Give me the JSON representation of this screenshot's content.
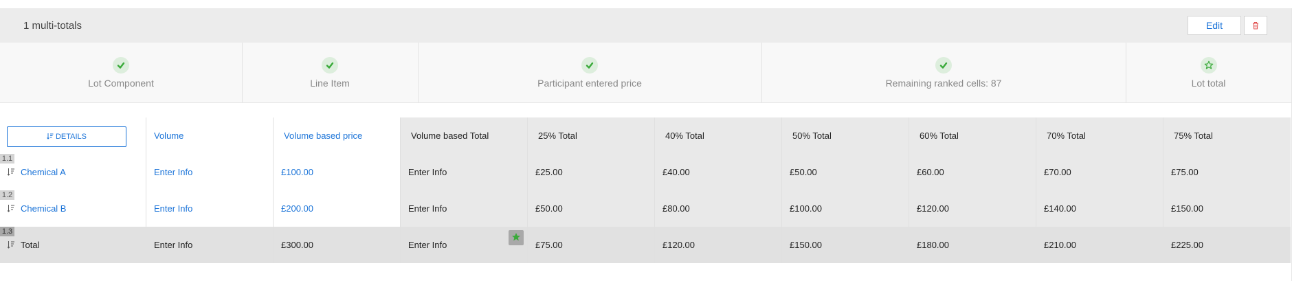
{
  "header": {
    "title": "1 multi-totals",
    "edit_label": "Edit"
  },
  "steps": [
    {
      "label": "Lot Component",
      "icon": "check-icon",
      "status": "complete"
    },
    {
      "label": "Line Item",
      "icon": "check-icon",
      "status": "complete"
    },
    {
      "label": "Participant entered price",
      "icon": "check-icon",
      "status": "complete"
    },
    {
      "label": "Remaining ranked cells: 87",
      "icon": "check-icon",
      "status": "complete"
    },
    {
      "label": "Lot total",
      "icon": "star-outline-icon",
      "status": "pending"
    }
  ],
  "table": {
    "details_label": "DETAILS",
    "columns": [
      "Volume",
      "Volume based price",
      "Volume based Total",
      "25% Total",
      "40% Total",
      "50% Total",
      "60% Total",
      "70% Total",
      "75% Total"
    ],
    "rows": [
      {
        "num": "1.1",
        "name": "Chemical A",
        "cells": [
          "Enter Info",
          "£100.00",
          "Enter Info",
          "£25.00",
          "£40.00",
          "£50.00",
          "£60.00",
          "£70.00",
          "£75.00"
        ]
      },
      {
        "num": "1.2",
        "name": "Chemical B",
        "cells": [
          "Enter Info",
          "£200.00",
          "Enter Info",
          "£50.00",
          "£80.00",
          "£100.00",
          "£120.00",
          "£140.00",
          "£150.00"
        ]
      },
      {
        "num": "1.3",
        "name": "Total",
        "cells": [
          "Enter Info",
          "£300.00",
          "Enter Info",
          "£75.00",
          "£120.00",
          "£150.00",
          "£180.00",
          "£210.00",
          "£225.00"
        ]
      }
    ]
  },
  "colors": {
    "accent": "#1a73d8",
    "success": "#3aaa3a",
    "danger": "#e04848"
  }
}
